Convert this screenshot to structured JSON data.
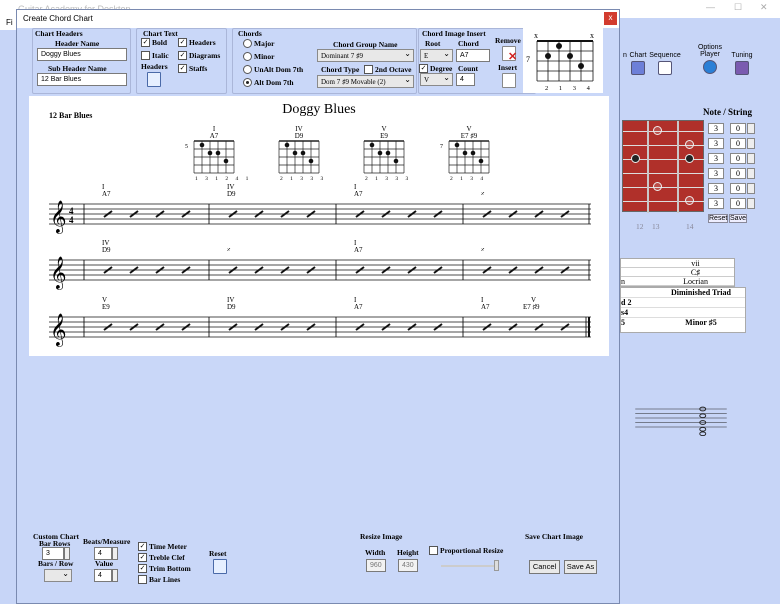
{
  "background": {
    "title": "Guitar Academy for Desktop",
    "menu_first": "Fi",
    "tools": [
      "n",
      "Chart",
      "Sequence",
      "Options",
      "Player",
      "Tuning"
    ],
    "note_string_title": "Note / String",
    "ns_rows": [
      [
        "3",
        "0"
      ],
      [
        "3",
        "0"
      ],
      [
        "3",
        "0"
      ],
      [
        "3",
        "0"
      ],
      [
        "3",
        "0"
      ],
      [
        "3",
        "0"
      ]
    ],
    "reset_label": "Reset",
    "save_label": "Save",
    "fret_numbers": [
      "12",
      "13",
      "14"
    ],
    "scale_rows": [
      [
        "",
        "vii"
      ],
      [
        "",
        "C♯"
      ],
      [
        "n",
        "Locrian"
      ]
    ],
    "list_rows": [
      [
        "",
        "Diminished Triad"
      ],
      [
        "d 2",
        ""
      ],
      [
        "s4",
        ""
      ],
      [
        "5",
        "Minor ♯5"
      ]
    ]
  },
  "dialog": {
    "title": "Create Chord Chart",
    "close": "x",
    "chart_headers": {
      "title": "Chart Headers",
      "header_name_label": "Header Name",
      "header_name_value": "Doggy Blues",
      "sub_header_label": "Sub Header Name",
      "sub_header_value": "12 Bar Blues"
    },
    "chart_text": {
      "title": "Chart Text",
      "bold": "Bold",
      "italic": "Italic",
      "headers": "Headers",
      "headers2": "Headers",
      "diagrams": "Diagrams",
      "staffs": "Staffs"
    },
    "chords": {
      "title": "Chords",
      "major": "Major",
      "minor": "Minor",
      "unalt": "UnAlt Dom 7th",
      "alt": "Alt Dom 7th",
      "group_label": "Chord Group Name",
      "group_value": "Dominant 7 ♯9",
      "type_label": "Chord Type",
      "octave_label": "2nd Octave",
      "type_value": "Dom 7 ♯9 Movable (2)"
    },
    "insert": {
      "title": "Chord Image Insert",
      "root_label": "Root",
      "chord_label": "Chord",
      "root_value": "E",
      "chord_value": "A7",
      "degree_label": "Degree",
      "count_label": "Count",
      "degree_value": "V",
      "count_value": "4",
      "remove": "Remove",
      "insert": "Insert",
      "preview_fret": "7",
      "preview_fingers": "2 1 3 4"
    },
    "canvas": {
      "title": "Doggy Blues",
      "subtitle": "12 Bar Blues",
      "diagrams": [
        {
          "degree": "I",
          "chord": "A7",
          "fret": "5",
          "fingers": "1 3 1 2 4 1"
        },
        {
          "degree": "IV",
          "chord": "D9",
          "fret": "",
          "fingers": "2 1 3 3 3"
        },
        {
          "degree": "V",
          "chord": "E9",
          "fret": "",
          "fingers": "2 1 3 3 3"
        },
        {
          "degree": "V",
          "chord": "E7 ♯9",
          "fret": "7",
          "fingers": "2 1 3 4"
        }
      ],
      "rows": [
        [
          {
            "degree": "I",
            "chord": "A7"
          },
          {
            "degree": "IV",
            "chord": "D9"
          },
          {
            "degree": "I",
            "chord": "A7"
          },
          {
            "degree": "",
            "chord": "𝄎"
          }
        ],
        [
          {
            "degree": "IV",
            "chord": "D9"
          },
          {
            "degree": "",
            "chord": "𝄎"
          },
          {
            "degree": "I",
            "chord": "A7"
          },
          {
            "degree": "",
            "chord": "𝄎"
          }
        ],
        [
          {
            "degree": "V",
            "chord": "E9"
          },
          {
            "degree": "IV",
            "chord": "D9"
          },
          {
            "degree": "I",
            "chord": "A7"
          },
          {
            "degree": "I",
            "chord": "A7"
          }
        ]
      ],
      "last_extra": {
        "degree": "V",
        "chord": "E7 ♯9"
      },
      "time_sig_top": "4",
      "time_sig_bottom": "4"
    },
    "custom": {
      "title": "Custom Chart",
      "bar_rows_label": "Bar Rows",
      "bar_rows_value": "3",
      "beats_label": "Beats/Measure",
      "beats_value": "4",
      "bars_row_label": "Bars / Row",
      "value_label": "Value",
      "value_value": "4",
      "time_meter": "Time Meter",
      "treble_clef": "Treble Clef",
      "trim_bottom": "Trim Bottom",
      "bar_lines": "Bar Lines",
      "reset": "Reset"
    },
    "resize": {
      "title": "Resize Image",
      "width_label": "Width",
      "height_label": "Height",
      "width_value": "960",
      "height_value": "430",
      "proportional": "Proportional Resize"
    },
    "save": {
      "title": "Save Chart Image",
      "cancel": "Cancel",
      "save_as": "Save As"
    }
  }
}
